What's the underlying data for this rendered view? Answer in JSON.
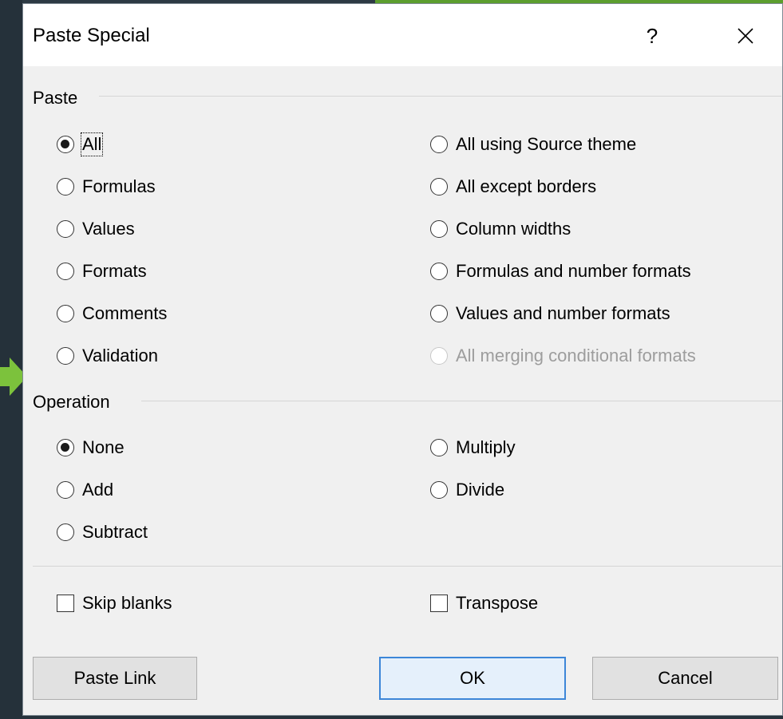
{
  "dialog": {
    "title": "Paste Special",
    "help_label": "?",
    "close_label": "×"
  },
  "paste": {
    "label": "Paste",
    "left_options": [
      {
        "label": "All",
        "checked": true
      },
      {
        "label": "Formulas",
        "checked": false
      },
      {
        "label": "Values",
        "checked": false
      },
      {
        "label": "Formats",
        "checked": false
      },
      {
        "label": "Comments",
        "checked": false
      },
      {
        "label": "Validation",
        "checked": false
      }
    ],
    "right_options": [
      {
        "label": "All using Source theme",
        "checked": false,
        "enabled": true
      },
      {
        "label": "All except borders",
        "checked": false,
        "enabled": true
      },
      {
        "label": "Column widths",
        "checked": false,
        "enabled": true
      },
      {
        "label": "Formulas and number formats",
        "checked": false,
        "enabled": true
      },
      {
        "label": "Values and number formats",
        "checked": false,
        "enabled": true
      },
      {
        "label": "All merging conditional formats",
        "checked": false,
        "enabled": false
      }
    ]
  },
  "operation": {
    "label": "Operation",
    "left_options": [
      {
        "label": "None",
        "checked": true
      },
      {
        "label": "Add",
        "checked": false
      },
      {
        "label": "Subtract",
        "checked": false
      }
    ],
    "right_options": [
      {
        "label": "Multiply",
        "checked": false
      },
      {
        "label": "Divide",
        "checked": false
      }
    ]
  },
  "checkboxes": {
    "skip_blanks": {
      "label": "Skip blanks",
      "checked": false
    },
    "transpose": {
      "label": "Transpose",
      "checked": false
    }
  },
  "buttons": {
    "paste_link": "Paste Link",
    "ok": "OK",
    "cancel": "Cancel"
  },
  "colors": {
    "accent": "#3c86d8",
    "background_green": "#5c9e2e",
    "background_dark": "#26323c"
  }
}
